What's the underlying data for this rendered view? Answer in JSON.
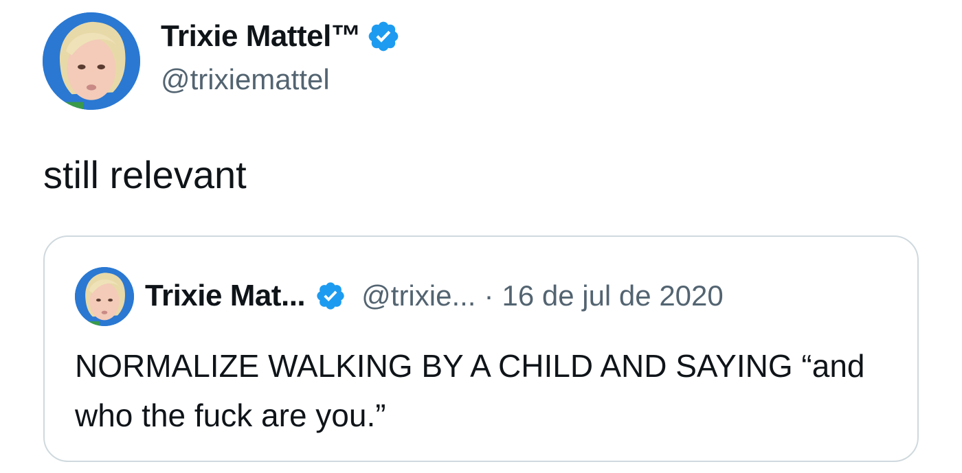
{
  "author": {
    "display_name": "Trixie Mattel™",
    "handle": "@trixiemattel",
    "verified_icon": "verified-badge-icon"
  },
  "tweet": {
    "text": "still relevant"
  },
  "quoted_tweet": {
    "display_name": "Trixie Mat...",
    "handle": "@trixie...",
    "separator": "·",
    "date": "16 de jul de 2020",
    "text": "NORMALIZE WALKING BY A CHILD AND SAYING “and who the fuck are you.”"
  },
  "colors": {
    "verified_blue": "#1d9bf0",
    "secondary_text": "#536471",
    "border": "#cfd9de"
  }
}
